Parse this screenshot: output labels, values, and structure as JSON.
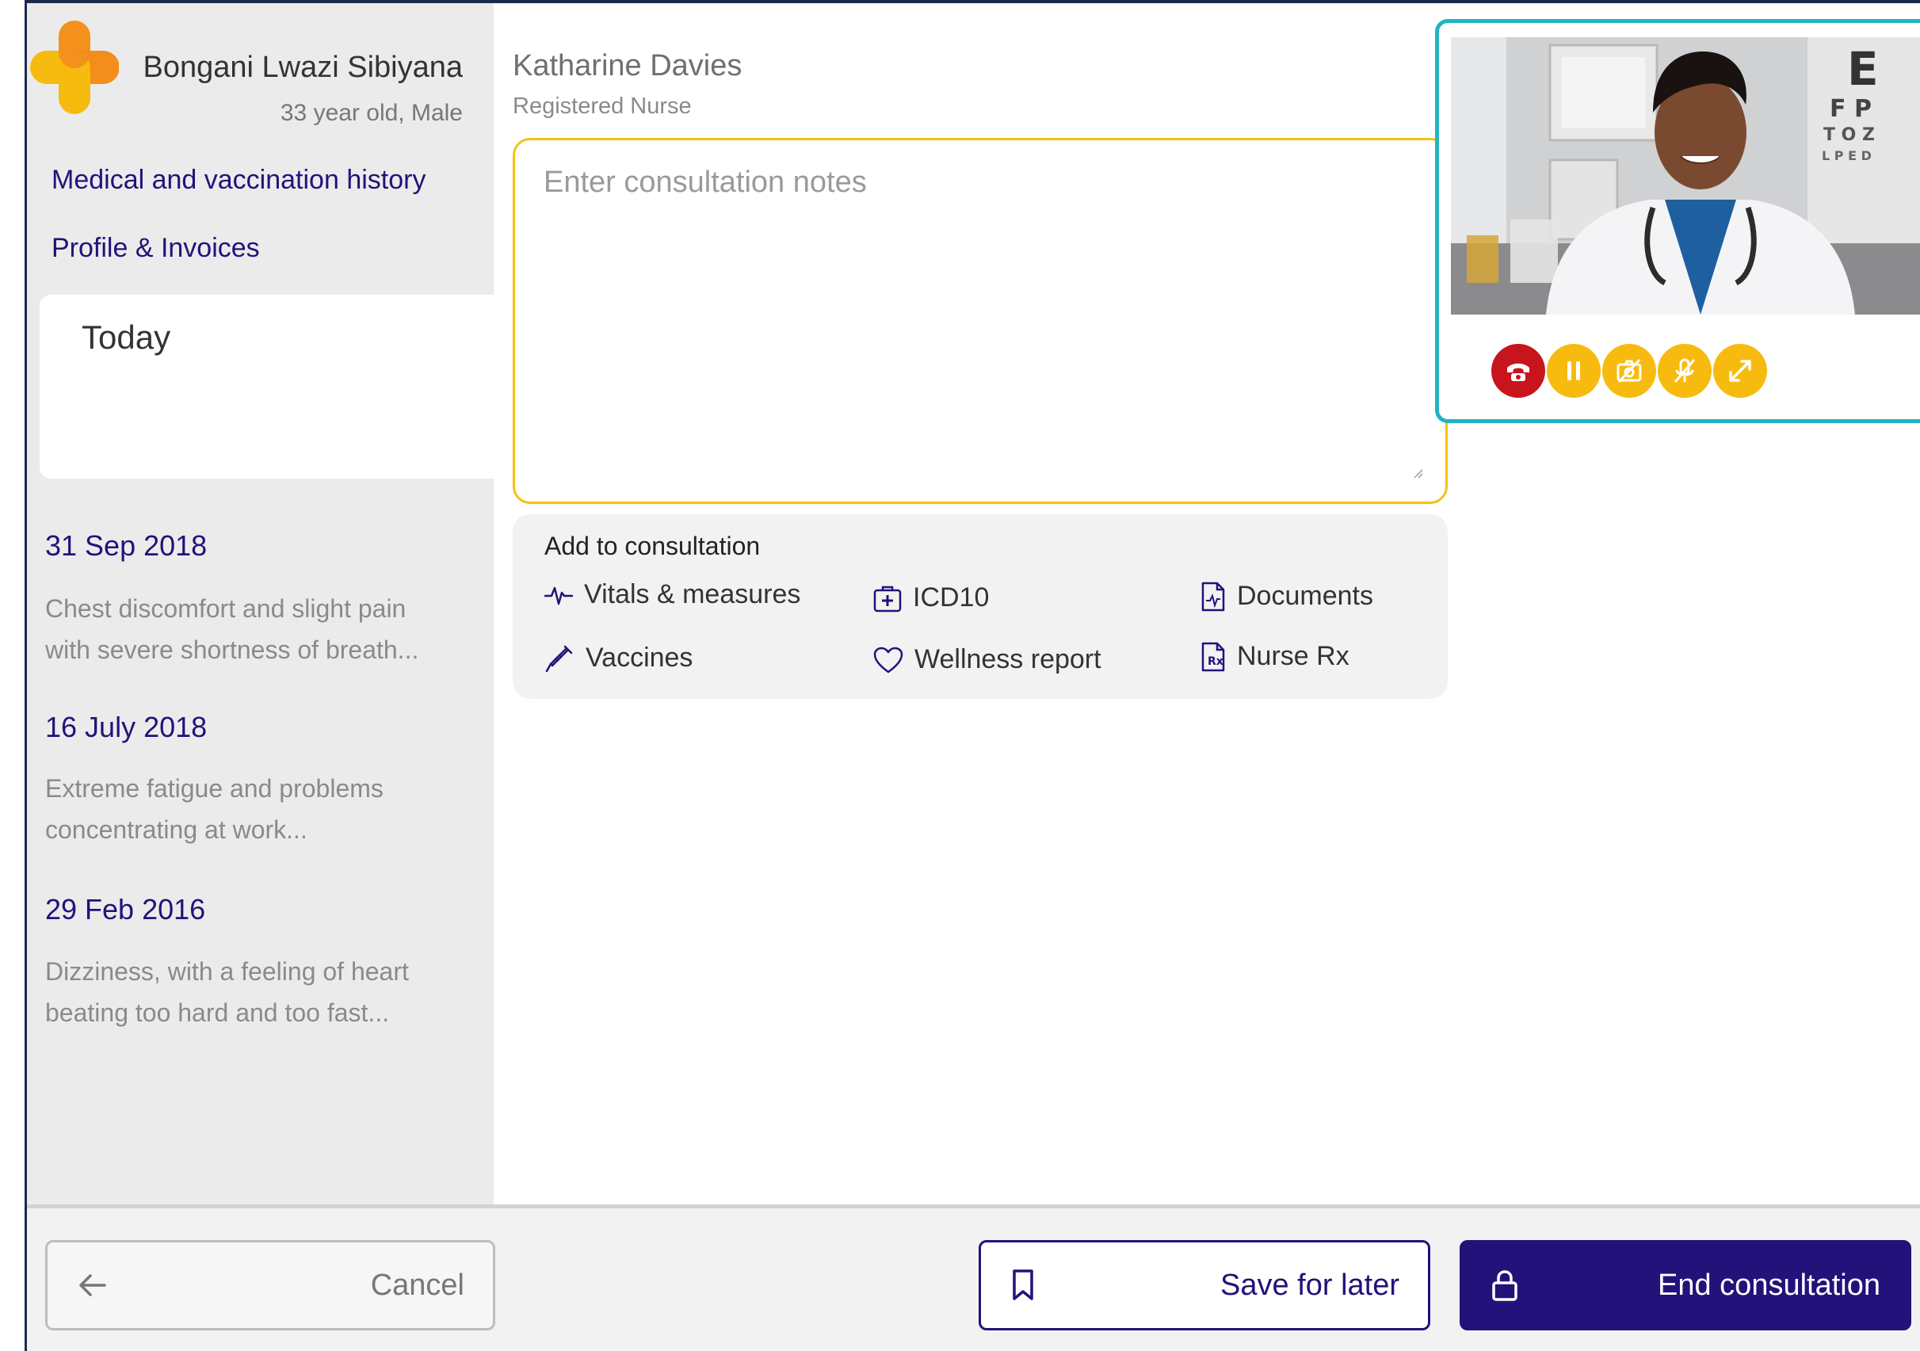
{
  "patient": {
    "name": "Bongani Lwazi Sibiyana",
    "meta": "33 year old, Male"
  },
  "sidebar": {
    "links": [
      "Medical and vaccination history",
      "Profile & Invoices"
    ],
    "today_label": "Today",
    "history": [
      {
        "date": "31 Sep 2018",
        "summary": "Chest discomfort and slight pain with severe shortness of breath..."
      },
      {
        "date": "16 July 2018",
        "summary": "Extreme fatigue and problems concentrating at work..."
      },
      {
        "date": "29 Feb 2016",
        "summary": "Dizziness, with a feeling of heart beating too hard and too fast..."
      }
    ]
  },
  "clinician": {
    "name": "Katharine Davies",
    "role": "Registered Nurse"
  },
  "notes": {
    "placeholder": "Enter consultation notes",
    "value": ""
  },
  "add_panel": {
    "title": "Add to consultation",
    "items": {
      "vitals": "Vitals & measures",
      "icd10": "ICD10",
      "documents": "Documents",
      "vaccines": "Vaccines",
      "wellness": "Wellness report",
      "nurse_rx": "Nurse Rx"
    }
  },
  "video_controls": [
    "phone-hangup-icon",
    "pause-icon",
    "camera-off-icon",
    "mic-off-icon",
    "expand-icon"
  ],
  "colors": {
    "brand": "#23127a",
    "accent_yellow": "#f7bb0f",
    "hangup_red": "#c8141c",
    "video_border": "#23b3c2"
  },
  "footer": {
    "cancel_label": "Cancel",
    "save_label": "Save for later",
    "end_label": "End consultation"
  }
}
